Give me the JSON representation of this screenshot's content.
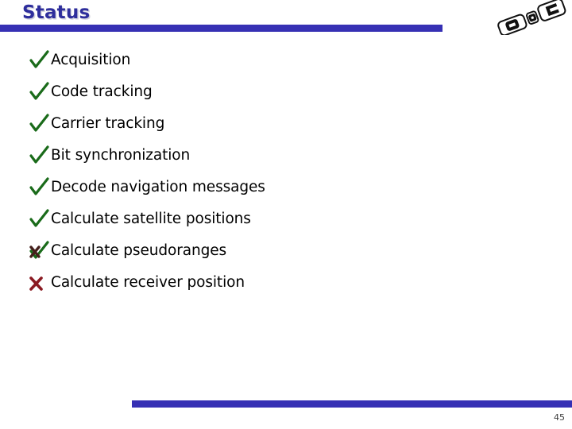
{
  "slide": {
    "title": "Status",
    "page_number": "45"
  },
  "theme": {
    "accent_blue": "#3630b4",
    "title_color": "#2e2e9c",
    "check_green": "#1a6b1a",
    "cross_red": "#8b1a22",
    "text_black": "#000000",
    "background": "#ffffff"
  },
  "logo": {
    "name": "company-logo",
    "description": "three rotated rounded rectangles"
  },
  "bullets": [
    {
      "label": "Acquisition",
      "marks": [
        "check"
      ],
      "mark_icon": "check-icon"
    },
    {
      "label": "Code tracking",
      "marks": [
        "check"
      ],
      "mark_icon": "check-icon"
    },
    {
      "label": "Carrier tracking",
      "marks": [
        "check"
      ],
      "mark_icon": "check-icon"
    },
    {
      "label": "Bit synchronization",
      "marks": [
        "check"
      ],
      "mark_icon": "check-icon"
    },
    {
      "label": "Decode navigation messages",
      "marks": [
        "check"
      ],
      "mark_icon": "check-icon"
    },
    {
      "label": "Calculate satellite positions",
      "marks": [
        "check"
      ],
      "mark_icon": "check-icon"
    },
    {
      "label": "Calculate pseudoranges",
      "marks": [
        "check",
        "cross"
      ],
      "mark_icon": "check-cross-icon"
    },
    {
      "label": "Calculate receiver position",
      "marks": [
        "cross"
      ],
      "mark_icon": "cross-icon"
    }
  ]
}
